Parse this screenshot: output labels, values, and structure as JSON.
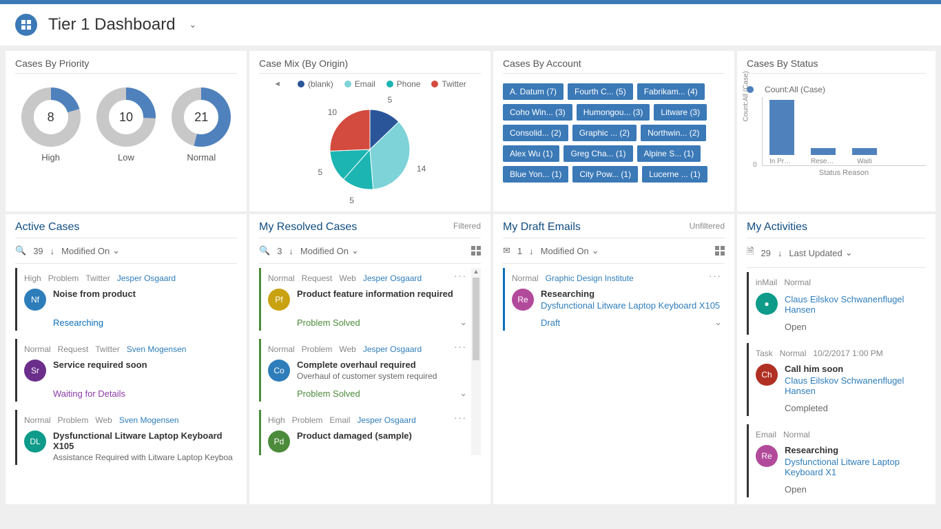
{
  "header": {
    "title": "Tier 1 Dashboard"
  },
  "casesByPriority": {
    "title": "Cases By Priority",
    "items": [
      {
        "label": "High",
        "value": 8,
        "total": 39
      },
      {
        "label": "Low",
        "value": 10,
        "total": 39
      },
      {
        "label": "Normal",
        "value": 21,
        "total": 39
      }
    ]
  },
  "caseMix": {
    "title": "Case Mix (By Origin)",
    "legend": [
      {
        "label": "(blank)",
        "color": "#2A5599"
      },
      {
        "label": "Email",
        "color": "#7ED3D8"
      },
      {
        "label": "Phone",
        "color": "#1CB5B2"
      },
      {
        "label": "Twitter",
        "color": "#D34B3E"
      }
    ],
    "slices": [
      {
        "label": "5",
        "value": 5,
        "color": "#2A5599"
      },
      {
        "label": "14",
        "value": 14,
        "color": "#7ED3D8"
      },
      {
        "label": "5",
        "value": 5,
        "color": "#1CB5B2"
      },
      {
        "label": "5",
        "value": 5,
        "color": "#1CB5B2"
      },
      {
        "label": "10",
        "value": 10,
        "color": "#D34B3E"
      }
    ]
  },
  "casesByAccount": {
    "title": "Cases By Account",
    "tags": [
      "A. Datum (7)",
      "Fourth C... (5)",
      "Fabrikam... (4)",
      "Coho Win... (3)",
      "Humongou... (3)",
      "Litware (3)",
      "Consolid... (2)",
      "Graphic ... (2)",
      "Northwin... (2)",
      "Alex Wu (1)",
      "Greg Cha... (1)",
      "Alpine S... (1)",
      "Blue Yon... (1)",
      "City Pow... (1)",
      "Lucerne ... (1)"
    ]
  },
  "casesByStatus": {
    "title": "Cases By Status",
    "legend": "Count:All (Case)",
    "ylabel": "Count:All (Case)",
    "xlabel": "Status Reason",
    "ytick": "0",
    "bars": [
      {
        "label": "In Progr...",
        "height": 80
      },
      {
        "label": "Researc...",
        "height": 10
      },
      {
        "label": "Waiti",
        "height": 10
      }
    ]
  },
  "chart_data": [
    {
      "type": "bar",
      "title": "Cases By Priority",
      "categories": [
        "High",
        "Low",
        "Normal"
      ],
      "values": [
        8,
        10,
        21
      ]
    },
    {
      "type": "pie",
      "title": "Case Mix (By Origin)",
      "categories": [
        "(blank)",
        "Email",
        "Phone",
        "Phone",
        "Twitter"
      ],
      "values": [
        5,
        14,
        5,
        5,
        10
      ]
    },
    {
      "type": "bar",
      "title": "Cases By Status",
      "xlabel": "Status Reason",
      "ylabel": "Count:All (Case)",
      "categories": [
        "In Progress",
        "Researching",
        "Waiting"
      ],
      "values": [
        32,
        4,
        4
      ],
      "ylim": [
        0,
        35
      ]
    }
  ],
  "activeCases": {
    "title": "Active Cases",
    "count": "39",
    "sort": "Modified On",
    "items": [
      {
        "border": "item",
        "meta": [
          "High",
          "Problem",
          "Twitter"
        ],
        "owner": "Jesper Osgaard",
        "avatar": "Nf",
        "avColor": "#2E7DBB",
        "title": "Noise from product",
        "sub": "",
        "status": "Researching",
        "statusClass": "status-research"
      },
      {
        "border": "item",
        "meta": [
          "Normal",
          "Request",
          "Twitter"
        ],
        "owner": "Sven Mogensen",
        "avatar": "Sr",
        "avColor": "#6B2E8B",
        "title": "Service required soon",
        "sub": "",
        "status": "Waiting for Details",
        "statusClass": "status-waiting"
      },
      {
        "border": "item",
        "meta": [
          "Normal",
          "Problem",
          "Web"
        ],
        "owner": "Sven Mogensen",
        "avatar": "DL",
        "avColor": "#0E9B8A",
        "title": "Dysfunctional Litware Laptop Keyboard X105",
        "sub": "Assistance Required with Litware Laptop Keyboa",
        "status": "",
        "statusClass": ""
      }
    ]
  },
  "resolvedCases": {
    "title": "My Resolved Cases",
    "filter": "Filtered",
    "count": "3",
    "sort": "Modified On",
    "items": [
      {
        "border": "item green",
        "meta": [
          "Normal",
          "Request",
          "Web"
        ],
        "owner": "Jesper Osgaard",
        "avatar": "Pf",
        "avColor": "#C9A212",
        "title": "Product feature information required",
        "sub": "",
        "status": "Problem Solved",
        "statusClass": "status-solved",
        "expand": true,
        "more": true
      },
      {
        "border": "item green",
        "meta": [
          "Normal",
          "Problem",
          "Web"
        ],
        "owner": "Jesper Osgaard",
        "avatar": "Co",
        "avColor": "#2E7DBB",
        "title": "Complete overhaul required",
        "sub": "Overhaul of customer system required",
        "status": "Problem Solved",
        "statusClass": "status-solved",
        "expand": true,
        "more": true
      },
      {
        "border": "item green",
        "meta": [
          "High",
          "Problem",
          "Email"
        ],
        "owner": "Jesper Osgaard",
        "avatar": "Pd",
        "avColor": "#4B8B3B",
        "title": "Product damaged (sample)",
        "sub": "",
        "status": "",
        "statusClass": "",
        "more": true
      }
    ]
  },
  "draftEmails": {
    "title": "My Draft Emails",
    "filter": "Unfiltered",
    "count": "1",
    "sort": "Modified On",
    "items": [
      {
        "border": "item blue-border",
        "meta": [
          "Normal"
        ],
        "owner": "Graphic Design Institute",
        "avatar": "Re",
        "avColor": "#B24A9B",
        "title": "Researching",
        "link": "Dysfunctional Litware Laptop Keyboard X105",
        "status": "Draft",
        "statusClass": "status-draft",
        "expand": true,
        "more": true
      }
    ]
  },
  "activities": {
    "title": "My Activities",
    "count": "29",
    "sort": "Last Updated",
    "items": [
      {
        "border": "item",
        "meta": [
          "inMail",
          "Normal"
        ],
        "avatar": "●",
        "avColor": "#0E9B8A",
        "link": "Claus Eilskov Schwanenflugel Hansen",
        "status": "Open",
        "statusClass": "status-open"
      },
      {
        "border": "item",
        "meta": [
          "Task",
          "Normal",
          "10/2/2017 1:00 PM"
        ],
        "avatar": "Ch",
        "avColor": "#B03024",
        "title": "Call him soon",
        "link": "Claus Eilskov Schwanenflugel Hansen",
        "status": "Completed",
        "statusClass": "status-completed"
      },
      {
        "border": "item",
        "meta": [
          "Email",
          "Normal"
        ],
        "avatar": "Re",
        "avColor": "#B24A9B",
        "title": "Researching",
        "link": "Dysfunctional Litware Laptop Keyboard X1",
        "status": "Open",
        "statusClass": "status-open"
      }
    ]
  }
}
